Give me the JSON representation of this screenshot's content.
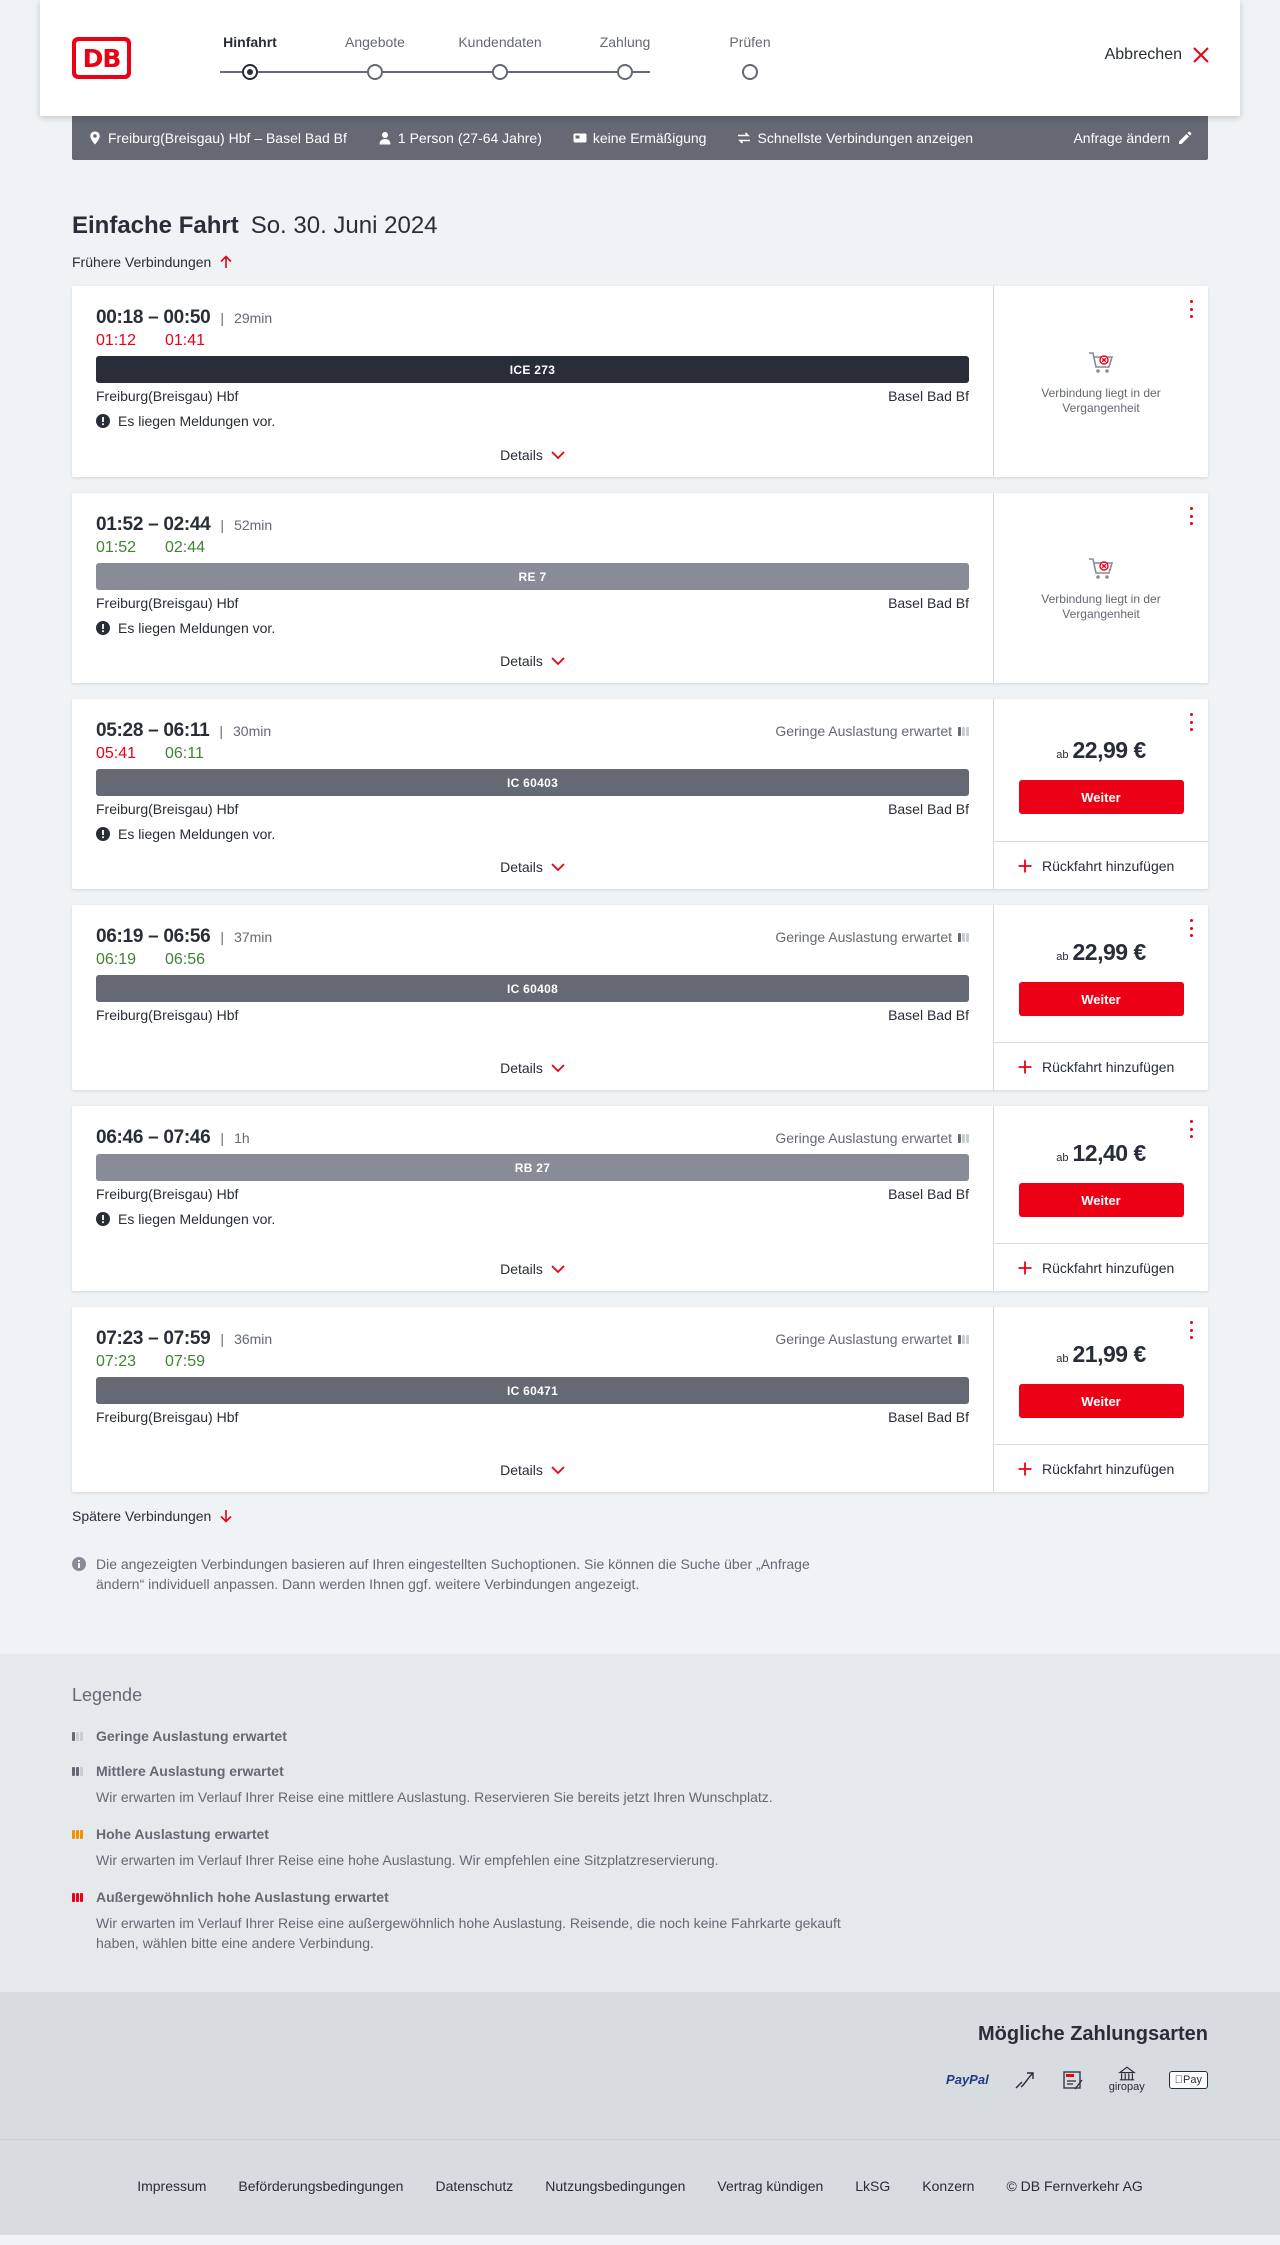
{
  "header": {
    "logo_text": "DB",
    "steps": [
      {
        "label": "Hinfahrt"
      },
      {
        "label": "Angebote"
      },
      {
        "label": "Kundendaten"
      },
      {
        "label": "Zahlung"
      },
      {
        "label": "Prüfen"
      }
    ],
    "active_step": "Hinfahrt",
    "cancel_label": "Abbrechen"
  },
  "searchbar": {
    "route": "Freiburg(Breisgau) Hbf – Basel Bad Bf",
    "passengers": "1 Person (27-64 Jahre)",
    "discount": "keine Ermäßigung",
    "fastest": "Schnellste Verbindungen anzeigen",
    "edit": "Anfrage ändern"
  },
  "main": {
    "title": "Einfache Fahrt",
    "date": "So. 30. Juni 2024",
    "earlier": "Frühere Verbindungen",
    "later": "Spätere Verbindungen",
    "info": "Die angezeigten Verbindungen basieren auf Ihren eingestellten Suchoptionen. Sie können die Suche über „Anfrage ändern“ individuell anpassen. Dann werden Ihnen ggf. weitere Verbindungen angezeigt."
  },
  "connections": [
    {
      "times": "00:18 – 00:50",
      "duration": "29min",
      "rt_dep": "01:12",
      "rt_arr": "01:41",
      "rt_dep_status": "late",
      "rt_arr_status": "late",
      "train": "ICE 273",
      "train_color": "#282d37",
      "from": "Freiburg(Breisgau) Hbf",
      "to": "Basel Bad Bf",
      "notice": "Es liegen Meldungen vor.",
      "details": "Details",
      "past": "Verbindung liegt in der Vergangenheit"
    },
    {
      "times": "01:52 – 02:44",
      "duration": "52min",
      "rt_dep": "01:52",
      "rt_arr": "02:44",
      "rt_dep_status": "ontime",
      "rt_arr_status": "ontime",
      "train": "RE 7",
      "train_color": "#878c96",
      "from": "Freiburg(Breisgau) Hbf",
      "to": "Basel Bad Bf",
      "notice": "Es liegen Meldungen vor.",
      "details": "Details",
      "past": "Verbindung liegt in der Vergangenheit"
    },
    {
      "times": "05:28 – 06:11",
      "duration": "30min",
      "load": "Geringe Auslastung erwartet",
      "rt_dep": "05:41",
      "rt_arr": "06:11",
      "rt_dep_status": "late",
      "rt_arr_status": "ontime",
      "train": "IC 60403",
      "train_color": "#646973",
      "from": "Freiburg(Breisgau) Hbf",
      "to": "Basel Bad Bf",
      "notice": "Es liegen Meldungen vor.",
      "details": "Details",
      "price_prefix": "ab",
      "price": "22,99 €",
      "weiter": "Weiter",
      "return": "Rückfahrt hinzufügen"
    },
    {
      "times": "06:19 – 06:56",
      "duration": "37min",
      "load": "Geringe Auslastung erwartet",
      "rt_dep": "06:19",
      "rt_arr": "06:56",
      "rt_dep_status": "ontime",
      "rt_arr_status": "ontime",
      "train": "IC 60408",
      "train_color": "#646973",
      "from": "Freiburg(Breisgau) Hbf",
      "to": "Basel Bad Bf",
      "details": "Details",
      "price_prefix": "ab",
      "price": "22,99 €",
      "weiter": "Weiter",
      "return": "Rückfahrt hinzufügen"
    },
    {
      "times": "06:46 – 07:46",
      "duration": "1h",
      "load": "Geringe Auslastung erwartet",
      "train": "RB 27",
      "train_color": "#878c96",
      "from": "Freiburg(Breisgau) Hbf",
      "to": "Basel Bad Bf",
      "notice": "Es liegen Meldungen vor.",
      "details": "Details",
      "price_prefix": "ab",
      "price": "12,40 €",
      "weiter": "Weiter",
      "return": "Rückfahrt hinzufügen"
    },
    {
      "times": "07:23 – 07:59",
      "duration": "36min",
      "load": "Geringe Auslastung erwartet",
      "rt_dep": "07:23",
      "rt_arr": "07:59",
      "rt_dep_status": "ontime",
      "rt_arr_status": "ontime",
      "train": "IC 60471",
      "train_color": "#646973",
      "from": "Freiburg(Breisgau) Hbf",
      "to": "Basel Bad Bf",
      "details": "Details",
      "price_prefix": "ab",
      "price": "21,99 €",
      "weiter": "Weiter",
      "return": "Rückfahrt hinzufügen"
    }
  ],
  "legend": {
    "title": "Legende",
    "items": [
      {
        "icon": "load-low-icon",
        "level": "l1",
        "title": "Geringe Auslastung erwartet",
        "desc": ""
      },
      {
        "icon": "load-medium-icon",
        "level": "l2",
        "title": "Mittlere Auslastung erwartet",
        "desc": "Wir erwarten im Verlauf Ihrer Reise eine mittlere Auslastung. Reservieren Sie bereits jetzt Ihren Wunschplatz."
      },
      {
        "icon": "load-high-icon",
        "level": "l3",
        "title": "Hohe Auslastung erwartet",
        "desc": "Wir erwarten im Verlauf Ihrer Reise eine hohe Auslastung. Wir empfehlen eine Sitzplatzreservierung."
      },
      {
        "icon": "load-extreme-icon",
        "level": "l4",
        "title": "Außergewöhnlich hohe Auslastung erwartet",
        "desc": "Wir erwarten im Verlauf Ihrer Reise eine außergewöhnlich hohe Auslastung. Reisende, die noch keine Fahrkarte gekauft haben, wählen bitte eine andere Verbindung."
      }
    ]
  },
  "payment": {
    "title": "Mögliche Zahlungsarten",
    "methods": [
      "PayPal",
      "Lastschrift",
      "SEPA",
      "giropay",
      "Apple Pay"
    ],
    "giropay_label": "giropay",
    "paypal_label": "PayPal",
    "applepay_label": "Pay"
  },
  "footer": {
    "links": [
      "Impressum",
      "Beförderungsbedingungen",
      "Datenschutz",
      "Nutzungsbedingungen",
      "Vertrag kündigen",
      "LkSG",
      "Konzern",
      "© DB Fernverkehr AG"
    ]
  },
  "colors": {
    "accent": "#ec0016",
    "late": "#ec0016",
    "ontime": "#408335",
    "bar_dark": "#646973"
  }
}
